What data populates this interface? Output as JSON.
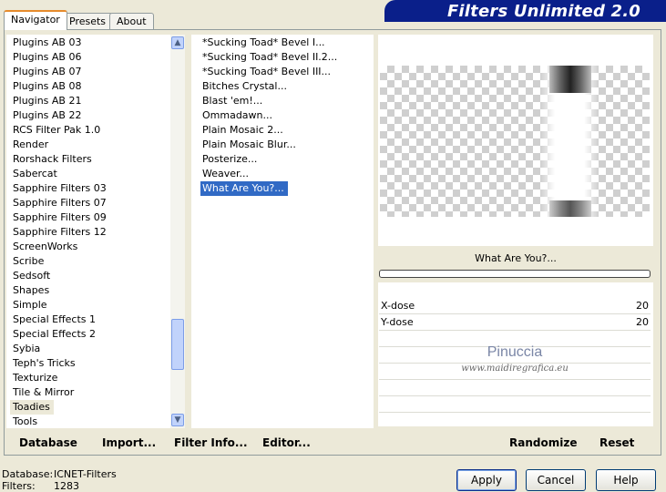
{
  "tabs": [
    "Navigator",
    "Presets",
    "About"
  ],
  "app_title": "Filters Unlimited 2.0",
  "categories": [
    "Plugins AB 03",
    "Plugins AB 06",
    "Plugins AB 07",
    "Plugins AB 08",
    "Plugins AB 21",
    "Plugins AB 22",
    "RCS Filter Pak 1.0",
    "Render",
    "Rorshack Filters",
    "Sabercat",
    "Sapphire Filters 03",
    "Sapphire Filters 07",
    "Sapphire Filters 09",
    "Sapphire Filters 12",
    "ScreenWorks",
    "Scribe",
    "Sedsoft",
    "Shapes",
    "Simple",
    "Special Effects 1",
    "Special Effects 2",
    "Sybia",
    "Teph's Tricks",
    "Texturize",
    "Tile & Mirror",
    "Toadies",
    "Tools"
  ],
  "selected_category": "Toadies",
  "filters": [
    "*Sucking Toad*  Bevel I...",
    "*Sucking Toad*  Bevel II.2...",
    "*Sucking Toad*  Bevel III...",
    "Bitches Crystal...",
    "Blast 'em!...",
    "Ommadawn...",
    "Plain Mosaic 2...",
    "Plain Mosaic Blur...",
    "Posterize...",
    "Weaver...",
    "What Are You?..."
  ],
  "selected_filter": "What Are You?...",
  "preview": {
    "filter_name": "What Are You?...",
    "watermark_name": "Pinuccia",
    "watermark_url": "www.maidiregrafica.eu"
  },
  "params": [
    {
      "name": "X-dose",
      "value": "20"
    },
    {
      "name": "Y-dose",
      "value": "20"
    }
  ],
  "toolbar": {
    "database": "Database",
    "import": "Import...",
    "filter_info": "Filter Info...",
    "editor": "Editor...",
    "randomize": "Randomize",
    "reset": "Reset"
  },
  "status": {
    "database_label": "Database:",
    "database_value": "ICNET-Filters",
    "filters_label": "Filters:",
    "filters_value": "1283"
  },
  "buttons": {
    "apply": "Apply",
    "cancel": "Cancel",
    "help": "Help"
  }
}
